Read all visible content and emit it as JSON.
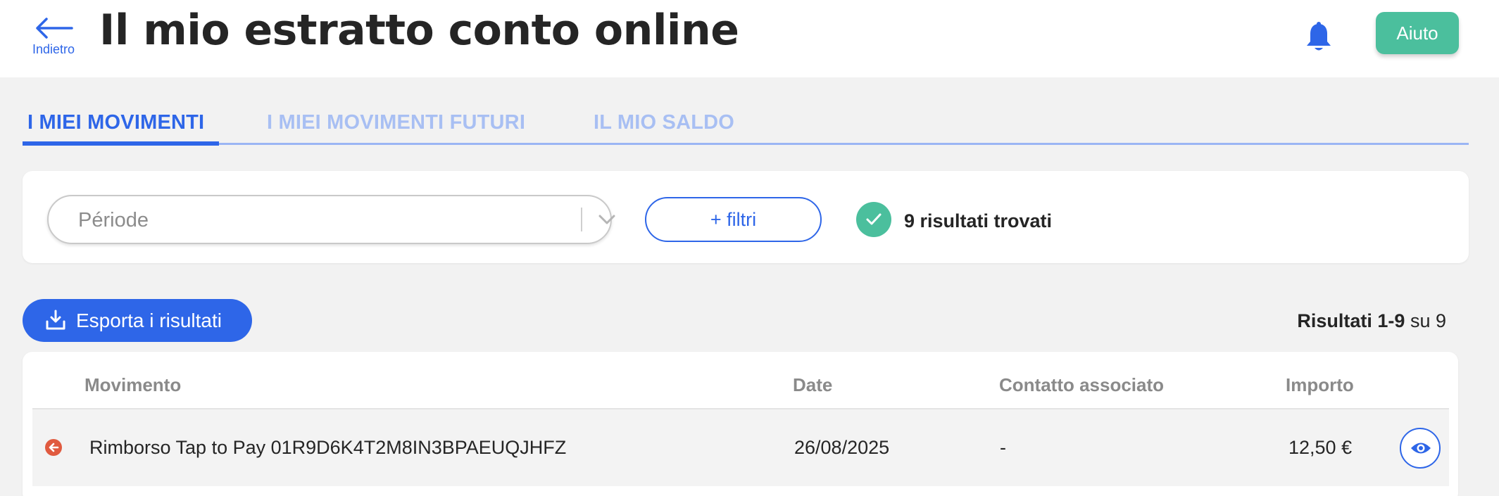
{
  "header": {
    "back_label": "Indietro",
    "title": "Il mio estratto conto online",
    "help_label": "Aiuto",
    "icons": {
      "back": "arrow-left-icon",
      "notifications": "bell-icon"
    }
  },
  "tabs": [
    {
      "label": "I MIEI MOVIMENTI",
      "active": true
    },
    {
      "label": "I MIEI MOVIMENTI FUTURI",
      "active": false
    },
    {
      "label": "IL MIO SALDO",
      "active": false
    }
  ],
  "filters": {
    "period_placeholder": "Période",
    "more_filters_label": "+ filtri",
    "results_found": "9 risultati trovati"
  },
  "actions": {
    "export_label": "Esporta i risultati",
    "range_bold": "Risultati 1-9",
    "range_rest": " su 9"
  },
  "table": {
    "columns": [
      "Movimento",
      "Date",
      "Contatto associato",
      "Importo"
    ],
    "rows": [
      {
        "movement": "Rimborso Tap to Pay 01R9D6K4T2M8IN3BPAEUQJHFZ",
        "date": "26/08/2025",
        "contact": "-",
        "amount": "12,50 €",
        "direction": "outgoing"
      }
    ]
  },
  "colors": {
    "primary": "#2e66e8",
    "accent_green": "#4bbf9d",
    "negative_red": "#e05a3f",
    "tab_inactive": "#a8bff3",
    "background": "#f2f2f2"
  }
}
